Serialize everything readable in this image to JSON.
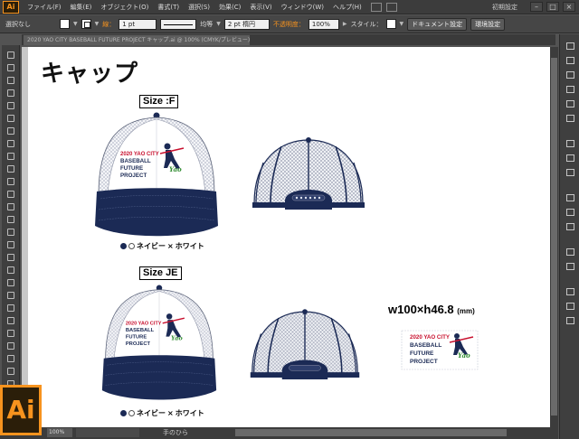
{
  "app": {
    "logo": "Ai",
    "menus": [
      "ファイル(F)",
      "編集(E)",
      "オブジェクト(O)",
      "書式(T)",
      "選択(S)",
      "効果(C)",
      "表示(V)",
      "ウィンドウ(W)",
      "ヘルプ(H)"
    ],
    "workspace": "初期設定"
  },
  "control_bar": {
    "selection": "選択なし",
    "stroke_label": "線：",
    "stroke_weight": "1 pt",
    "stroke_profile": "均等",
    "brush": "2 pt 楕円",
    "opacity_label": "不透明度：",
    "opacity_value": "100%",
    "style_label": "スタイル：",
    "doc_settings_button": "ドキュメント設定",
    "preferences_button": "環境設定"
  },
  "document": {
    "tab_title": "2020 YAO CITY BASEBALL FUTURE PROJECT キャップ.ai @ 100% (CMYK/プレビュー)",
    "zoom": "100%",
    "status_tool": "手のひら"
  },
  "artboard": {
    "title": "キャップ",
    "section1": {
      "size_label": "Size :F",
      "color_navy": "ネイビー",
      "color_white": "ホワイト",
      "separator": "×"
    },
    "section2": {
      "size_label": "Size JE",
      "color_navy": "ネイビー",
      "color_white": "ホワイト",
      "separator": "×"
    },
    "logo_dimensions": "w100×h46.8",
    "logo_dimensions_unit": "(mm)",
    "logo_text": {
      "line1": "2020 YAO CITY",
      "line2": "BASEBALL",
      "line3": "FUTURE",
      "line4": "PROJECT",
      "script": "Yao"
    }
  },
  "colors": {
    "navy": "#1b2a55",
    "mesh": "#e6e8ee",
    "red": "#c8102e",
    "green": "#2e8b2e",
    "ai_orange": "#f7931e",
    "ui_dark": "#3c3c3c"
  }
}
